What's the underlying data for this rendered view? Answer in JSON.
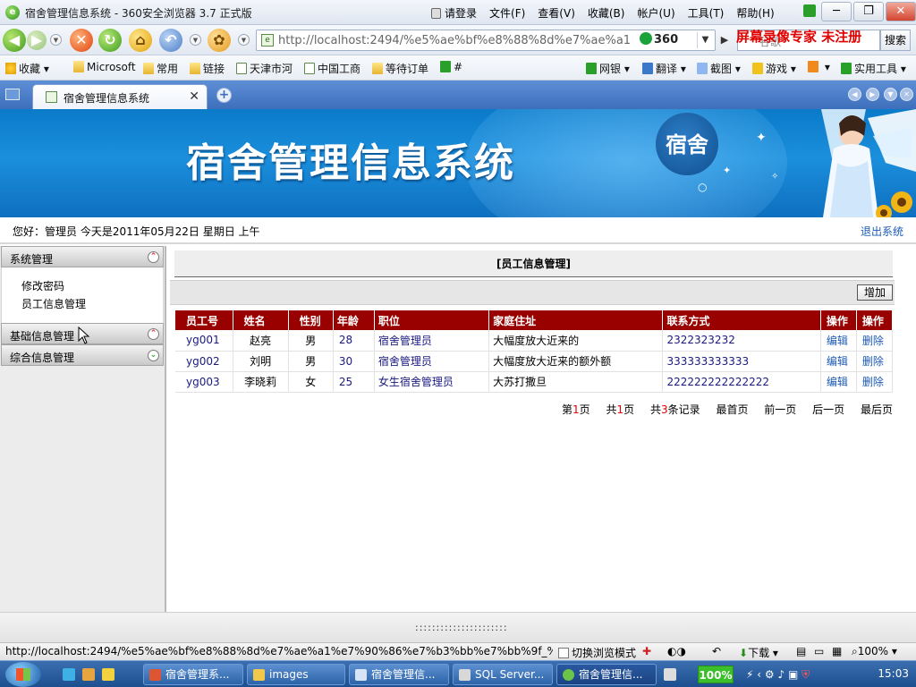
{
  "window": {
    "title": "宿舍管理信息系统 - 360安全浏览器 3.7 正式版",
    "login": "请登录",
    "menus": [
      "文件(F)",
      "查看(V)",
      "收藏(B)",
      "帐户(U)",
      "工具(T)",
      "帮助(H)"
    ]
  },
  "nav": {
    "address": "http://localhost:2494/%e5%ae%bf%e8%88%8d%e7%ae%a1",
    "badge": "360",
    "watermark": "屏幕录像专家  未注册",
    "search_label": "搜索",
    "search_placeholder": "谷歌"
  },
  "favorites": {
    "left": [
      "收藏",
      "Microsoft",
      "常用",
      "链接",
      "天津市河",
      "中国工商",
      "等待订单",
      "#"
    ],
    "right": [
      "网银",
      "翻译",
      "截图",
      "游戏",
      "实用工具"
    ]
  },
  "tab": {
    "label": "宿舍管理信息系统"
  },
  "banner": {
    "title": "宿舍管理信息系统",
    "seal": "宿舍"
  },
  "greeting": {
    "text": "您好：管理员    今天是2011年05月22日    星期日    上午",
    "logout": "退出系统"
  },
  "sidebar": {
    "sections": [
      {
        "label": "系统管理",
        "expanded": true,
        "items": [
          "修改密码",
          "员工信息管理"
        ]
      },
      {
        "label": "基础信息管理",
        "expanded": false
      },
      {
        "label": "综合信息管理",
        "expanded": false
      }
    ]
  },
  "main": {
    "panel_title": "[员工信息管理]",
    "add_label": "增加",
    "columns": [
      "员工号",
      "姓名",
      "性别",
      "年龄",
      "职位",
      "家庭住址",
      "联系方式",
      "操作",
      "操作"
    ],
    "rows": [
      {
        "id": "yg001",
        "name": "赵亮",
        "gender": "男",
        "age": "28",
        "position": "宿舍管理员",
        "address": "大幅度放大近来的",
        "phone": "2322323232",
        "edit": "编辑",
        "delete": "删除"
      },
      {
        "id": "yg002",
        "name": "刘明",
        "gender": "男",
        "age": "30",
        "position": "宿舍管理员",
        "address": "大幅度放大近来的额外额",
        "phone": "333333333333",
        "edit": "编辑",
        "delete": "删除"
      },
      {
        "id": "yg003",
        "name": "李晓莉",
        "gender": "女",
        "age": "25",
        "position": "女生宿舍管理员",
        "address": "大苏打撒旦",
        "phone": "222222222222222",
        "edit": "编辑",
        "delete": "删除"
      }
    ],
    "pager": {
      "page_prefix": "第",
      "page_num": "1",
      "page_suffix": "页",
      "total_prefix": "共",
      "total_num": "1",
      "total_suffix": "页",
      "records_prefix": "共",
      "records_num": "3",
      "records_suffix": "条记录",
      "first": "最首页",
      "prev": "前一页",
      "next": "后一页",
      "last": "最后页"
    }
  },
  "splitter": {
    "dots": "::::::::::::::::::::::"
  },
  "statusbar": {
    "url": "http://localhost:2494/%e5%ae%bf%e8%88%8d%e7%ae%a1%e7%90%86%e7%b3%bb%e7%bb%9f_%...",
    "mode": "切换浏览模式",
    "download": "下载",
    "zoom": "100%"
  },
  "taskbar": {
    "tasks": [
      "宿舍管理系...",
      "images",
      "宿舍管理信...",
      "SQL Server...",
      "宿舍管理信..."
    ],
    "zoom": "100%",
    "clock": "15:03"
  }
}
